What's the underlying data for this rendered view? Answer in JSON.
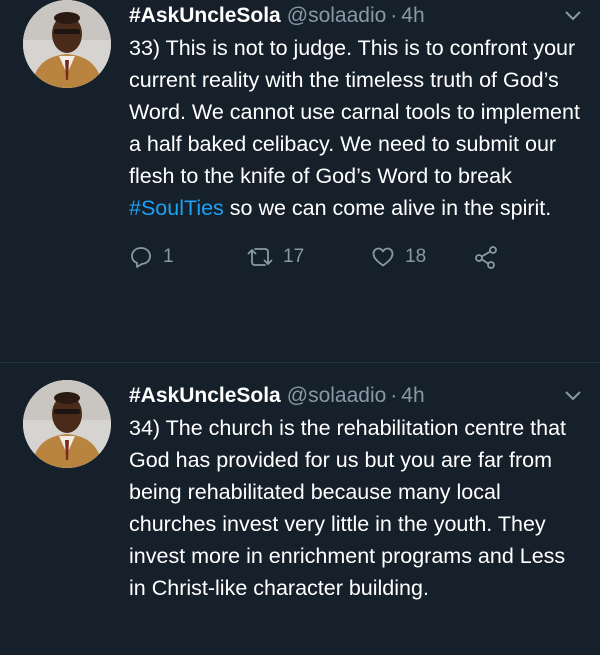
{
  "tweets": [
    {
      "display_name": "#AskUncleSola",
      "handle": "@solaadio",
      "separator": "·",
      "time": "4h",
      "text_before_tag": "33) This is not to judge. This is to confront your current reality with the timeless truth of God’s Word. We cannot use carnal tools to implement a half baked celibacy. We need to submit our flesh to the knife of God’s Word to break ",
      "hashtag": "#SoulTies",
      "text_after_tag": " so we can come alive in the spirit.",
      "reply_count": "1",
      "retweet_count": "17",
      "like_count": "18"
    },
    {
      "display_name": "#AskUncleSola",
      "handle": "@solaadio",
      "separator": "·",
      "time": "4h",
      "text": "34) The church is the rehabilitation centre that God has provided for us but you are far from being rehabilitated because many local churches invest very little in the youth. They invest more in enrichment programs and Less in Christ-like character building."
    }
  ],
  "colors": {
    "background": "#15202b",
    "text": "#ffffff",
    "secondary": "#8899a6",
    "link": "#1da1f2",
    "divider": "#253341"
  },
  "icons": [
    "avatar",
    "chevron-down-icon",
    "reply-icon",
    "retweet-icon",
    "like-icon",
    "share-icon"
  ]
}
